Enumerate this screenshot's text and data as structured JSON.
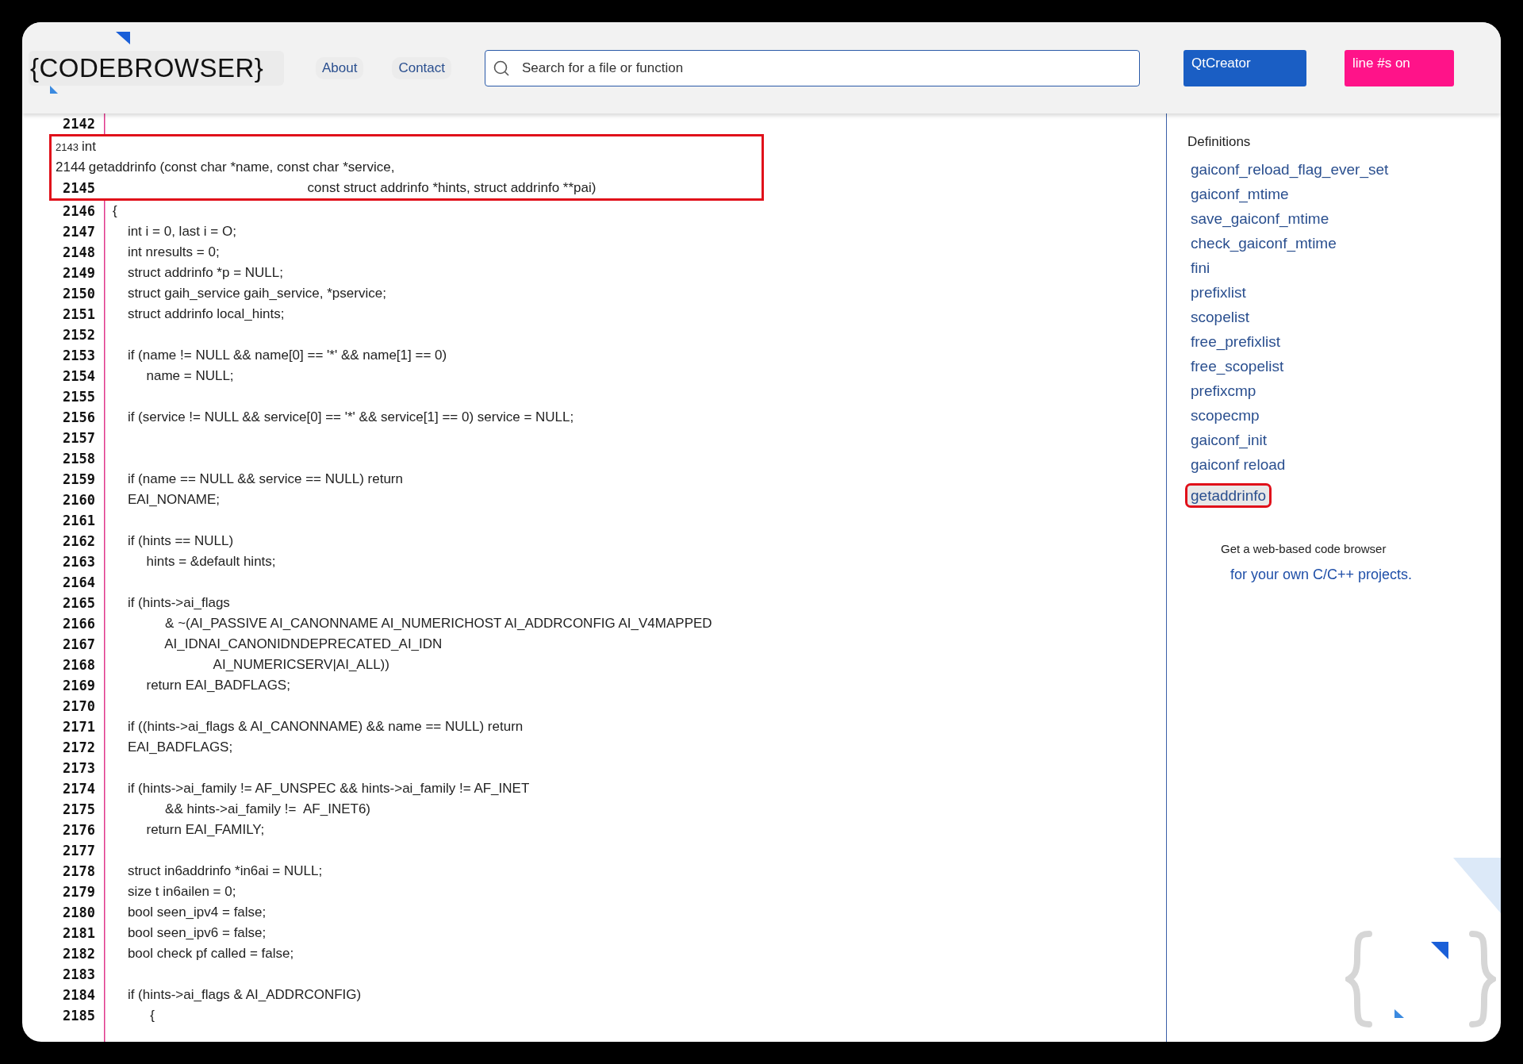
{
  "header": {
    "logo": "{CODEBROWSER}",
    "nav": [
      "About",
      "Contact"
    ],
    "search": {
      "placeholder": "Search for a file or function"
    },
    "buttons": [
      {
        "label": "QtCreator",
        "kind": "editor"
      },
      {
        "label": "line #s on",
        "kind": "toggle"
      }
    ]
  },
  "code": {
    "lines": [
      {
        "number": "2142",
        "kind": "gutter",
        "highlighted": false
      },
      {
        "number": "2143",
        "text": "int",
        "kind": "inline",
        "highlighted": true
      },
      {
        "number": "2144",
        "text": "getaddrinfo (const char *name, const char *service,",
        "kind": "inline",
        "highlighted": true
      },
      {
        "number": "2145",
        "text": "                                                    const struct addrinfo *hints, struct addrinfo **pai)",
        "kind": "gutter",
        "highlighted": true
      },
      {
        "number": "2146",
        "text": "{",
        "kind": "gutter",
        "highlighted": false
      },
      {
        "number": "2147",
        "text": "    int i = 0, last i = O;",
        "kind": "gutter",
        "highlighted": false
      },
      {
        "number": "2148",
        "text": "    int nresults = 0;",
        "kind": "gutter",
        "highlighted": false
      },
      {
        "number": "2149",
        "text": "    struct addrinfo *p = NULL;",
        "kind": "gutter",
        "highlighted": false
      },
      {
        "number": "2150",
        "text": "    struct gaih_service gaih_service, *pservice;",
        "kind": "gutter",
        "highlighted": false
      },
      {
        "number": "2151",
        "text": "    struct addrinfo local_hints;",
        "kind": "gutter",
        "highlighted": false
      },
      {
        "number": "2152",
        "kind": "gutter",
        "highlighted": false
      },
      {
        "number": "2153",
        "text": "    if (name != NULL && name[0] == '*' && name[1] == 0)",
        "kind": "gutter",
        "highlighted": false
      },
      {
        "number": "2154",
        "text": "         name = NULL;",
        "kind": "gutter",
        "highlighted": false
      },
      {
        "number": "2155",
        "kind": "gutter",
        "highlighted": false
      },
      {
        "number": "2156",
        "text": "    if (service != NULL && service[0] == '*' && service[1] == 0) service = NULL;",
        "kind": "gutter",
        "highlighted": false
      },
      {
        "number": "2157",
        "kind": "gutter",
        "highlighted": false
      },
      {
        "number": "2158",
        "kind": "gutter",
        "highlighted": false
      },
      {
        "number": "2159",
        "text": "    if (name == NULL && service == NULL) return",
        "kind": "gutter",
        "highlighted": false
      },
      {
        "number": "2160",
        "text": "    EAI_NONAME;",
        "kind": "gutter",
        "highlighted": false
      },
      {
        "number": "2161",
        "kind": "gutter",
        "highlighted": false
      },
      {
        "number": "2162",
        "text": "    if (hints == NULL)",
        "kind": "gutter",
        "highlighted": false
      },
      {
        "number": "2163",
        "text": "         hints = &default hints;",
        "kind": "gutter",
        "highlighted": false
      },
      {
        "number": "2164",
        "kind": "gutter",
        "highlighted": false
      },
      {
        "number": "2165",
        "text": "    if (hints->ai_flags",
        "kind": "gutter",
        "highlighted": false
      },
      {
        "number": "2166",
        "text": "              & ~(AI_PASSIVE AI_CANONNAME AI_NUMERICHOST AI_ADDRCONFIG AI_V4MAPPED",
        "kind": "gutter",
        "highlighted": false
      },
      {
        "number": "2167",
        "text": "              AI_IDNAI_CANONIDNDEPRECATED_AI_IDN",
        "kind": "gutter",
        "highlighted": false
      },
      {
        "number": "2168",
        "text": "                           AI_NUMERICSERV|AI_ALL))",
        "kind": "gutter",
        "highlighted": false
      },
      {
        "number": "2169",
        "text": "         return EAI_BADFLAGS;",
        "kind": "gutter",
        "highlighted": false
      },
      {
        "number": "2170",
        "kind": "gutter",
        "highlighted": false
      },
      {
        "number": "2171",
        "text": "    if ((hints->ai_flags & AI_CANONNAME) && name == NULL) return",
        "kind": "gutter",
        "highlighted": false
      },
      {
        "number": "2172",
        "text": "    EAI_BADFLAGS;",
        "kind": "gutter",
        "highlighted": false
      },
      {
        "number": "2173",
        "kind": "gutter",
        "highlighted": false
      },
      {
        "number": "2174",
        "text": "    if (hints->ai_family != AF_UNSPEC && hints->ai_family != AF_INET",
        "kind": "gutter",
        "highlighted": false
      },
      {
        "number": "2175",
        "text": "              && hints->ai_family !=  AF_INET6)",
        "kind": "gutter",
        "highlighted": false
      },
      {
        "number": "2176",
        "text": "         return EAI_FAMILY;",
        "kind": "gutter",
        "highlighted": false
      },
      {
        "number": "2177",
        "kind": "gutter",
        "highlighted": false
      },
      {
        "number": "2178",
        "text": "    struct in6addrinfo *in6ai = NULL;",
        "kind": "gutter",
        "highlighted": false
      },
      {
        "number": "2179",
        "text": "    size t in6ailen = 0;",
        "kind": "gutter",
        "highlighted": false
      },
      {
        "number": "2180",
        "text": "    bool seen_ipv4 = false;",
        "kind": "gutter",
        "highlighted": false
      },
      {
        "number": "2181",
        "text": "    bool seen_ipv6 = false;",
        "kind": "gutter",
        "highlighted": false
      },
      {
        "number": "2182",
        "text": "    bool check pf called = false;",
        "kind": "gutter",
        "highlighted": false
      },
      {
        "number": "2183",
        "kind": "gutter",
        "highlighted": false
      },
      {
        "number": "2184",
        "text": "    if (hints->ai_flags & AI_ADDRCONFIG)",
        "kind": "gutter",
        "highlighted": false
      },
      {
        "number": "2185",
        "text": "          {",
        "kind": "gutter",
        "highlighted": false
      }
    ]
  },
  "sidebar": {
    "title": "Definitions",
    "items": [
      {
        "label": "gaiconf_reload_flag_ever_set",
        "selected": false
      },
      {
        "label": "gaiconf_mtime",
        "selected": false
      },
      {
        "label": "save_gaiconf_mtime",
        "selected": false
      },
      {
        "label": "check_gaiconf_mtime",
        "selected": false
      },
      {
        "label": "fini",
        "selected": false
      },
      {
        "label": "prefixlist",
        "selected": false
      },
      {
        "label": "scopelist",
        "selected": false
      },
      {
        "label": "free_prefixlist",
        "selected": false
      },
      {
        "label": "free_scopelist",
        "selected": false
      },
      {
        "label": "prefixcmp",
        "selected": false
      },
      {
        "label": "scopecmp",
        "selected": false
      },
      {
        "label": "gaiconf_init",
        "selected": false
      },
      {
        "label": "gaiconf reload",
        "selected": false
      },
      {
        "label": "getaddrinfo",
        "selected": true
      }
    ],
    "promo": {
      "text": "Get a web-based code browser",
      "link": "for your own C/C++ projects."
    }
  }
}
